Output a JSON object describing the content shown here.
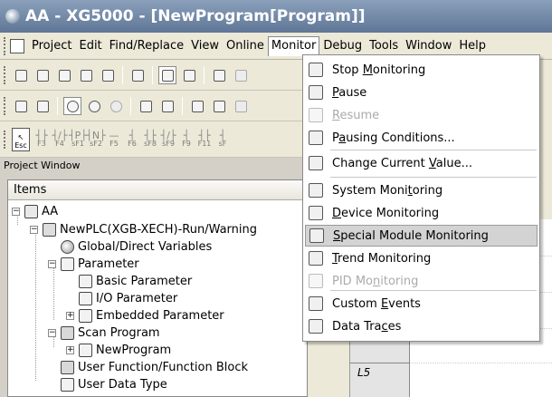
{
  "window": {
    "title": "AA - XG5000 - [NewProgram[Program]]"
  },
  "menubar": {
    "items": [
      {
        "name": "menu-project",
        "label": "Project"
      },
      {
        "name": "menu-edit",
        "label": "Edit"
      },
      {
        "name": "menu-find-replace",
        "label": "Find/Replace"
      },
      {
        "name": "menu-view",
        "label": "View"
      },
      {
        "name": "menu-online",
        "label": "Online"
      },
      {
        "name": "menu-monitor",
        "label": "Monitor"
      },
      {
        "name": "menu-debug",
        "label": "Debug"
      },
      {
        "name": "menu-tools",
        "label": "Tools"
      },
      {
        "name": "menu-window",
        "label": "Window"
      },
      {
        "name": "menu-help",
        "label": "Help"
      }
    ],
    "active": "Monitor"
  },
  "function_keys": [
    {
      "sym": "┤├",
      "label": "F3"
    },
    {
      "sym": "┤/├",
      "label": "F4"
    },
    {
      "sym": "┤P├",
      "label": "sF1"
    },
    {
      "sym": "┤N├",
      "label": "sF2"
    },
    {
      "sym": "—",
      "label": "F5"
    },
    {
      "sym": "┤",
      "label": "F6"
    },
    {
      "sym": "┤├",
      "label": "sF8"
    },
    {
      "sym": "┤/├",
      "label": "sF9"
    },
    {
      "sym": "┤",
      "label": "F9"
    },
    {
      "sym": "┤├",
      "label": "F11"
    },
    {
      "sym": "┤",
      "label": "sF"
    }
  ],
  "esc_key": "Esc",
  "project_window": {
    "title": "Project Window",
    "header": "Items",
    "tree": [
      {
        "label": "AA",
        "icon": "project-icon"
      },
      {
        "label": "NewPLC(XGB-XECH)-Run/Warning",
        "icon": "plc-icon"
      },
      {
        "label": "Global/Direct Variables",
        "icon": "globe-icon"
      },
      {
        "label": "Parameter",
        "icon": "parameter-folder-icon"
      },
      {
        "label": "Basic Parameter",
        "icon": "parameter-icon"
      },
      {
        "label": "I/O Parameter",
        "icon": "parameter-icon"
      },
      {
        "label": "Embedded Parameter",
        "icon": "parameter-icon"
      },
      {
        "label": "Scan Program",
        "icon": "scan-program-icon"
      },
      {
        "label": "NewProgram",
        "icon": "program-icon"
      },
      {
        "label": "User Function/Function Block",
        "icon": "function-block-icon"
      },
      {
        "label": "User Data Type",
        "icon": "data-type-icon"
      }
    ]
  },
  "ladder": {
    "rung_label": "L5"
  },
  "monitor_menu": {
    "items": [
      {
        "name": "stop-monitoring-item",
        "pre": "Stop ",
        "u": "M",
        "post": "onitoring",
        "icon": "stop-monitor-icon",
        "disabled": false,
        "highlighted": false
      },
      {
        "name": "pause-item",
        "pre": "",
        "u": "P",
        "post": "ause",
        "icon": "pause-icon",
        "disabled": false,
        "highlighted": false
      },
      {
        "name": "resume-item",
        "pre": "",
        "u": "R",
        "post": "esume",
        "icon": "resume-icon",
        "disabled": true,
        "highlighted": false
      },
      {
        "name": "pausing-conditions-item",
        "pre": "P",
        "u": "a",
        "post": "using Conditions...",
        "icon": "pausing-conditions-icon",
        "disabled": false,
        "highlighted": false
      },
      {
        "name": "change-current-value-item",
        "pre": "Change Current ",
        "u": "V",
        "post": "alue...",
        "icon": "change-value-icon",
        "disabled": false,
        "highlighted": false
      },
      {
        "name": "system-monitoring-item",
        "pre": "System Moni",
        "u": "t",
        "post": "oring",
        "icon": "system-monitoring-icon",
        "disabled": false,
        "highlighted": false
      },
      {
        "name": "device-monitoring-item",
        "pre": "",
        "u": "D",
        "post": "evice Monitoring",
        "icon": "device-monitoring-icon",
        "disabled": false,
        "highlighted": false
      },
      {
        "name": "special-module-monitoring-item",
        "pre": "",
        "u": "S",
        "post": "pecial Module Monitoring",
        "icon": "special-module-icon",
        "disabled": false,
        "highlighted": true
      },
      {
        "name": "trend-monitoring-item",
        "pre": "",
        "u": "T",
        "post": "rend Monitoring",
        "icon": "trend-icon",
        "disabled": false,
        "highlighted": false
      },
      {
        "name": "pid-monitoring-item",
        "pre": "PID Mo",
        "u": "n",
        "post": "itoring",
        "icon": "pid-icon",
        "disabled": true,
        "highlighted": false
      },
      {
        "name": "custom-events-item",
        "pre": "Custom ",
        "u": "E",
        "post": "vents",
        "icon": "custom-events-icon",
        "disabled": false,
        "highlighted": false
      },
      {
        "name": "data-traces-item",
        "pre": "Data Tra",
        "u": "c",
        "post": "es",
        "icon": "data-traces-icon",
        "disabled": false,
        "highlighted": false
      }
    ]
  }
}
